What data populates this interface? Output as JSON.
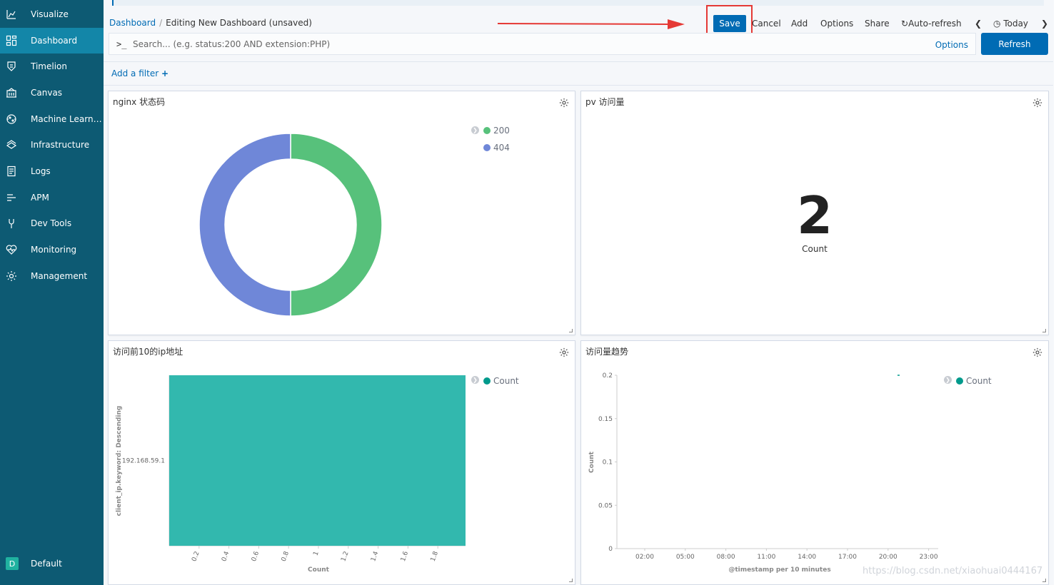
{
  "sidebar": {
    "items": [
      {
        "label": "Visualize",
        "icon": "visualize-icon"
      },
      {
        "label": "Dashboard",
        "icon": "dashboard-icon",
        "active": true
      },
      {
        "label": "Timelion",
        "icon": "timelion-icon"
      },
      {
        "label": "Canvas",
        "icon": "canvas-icon"
      },
      {
        "label": "Machine Learni...",
        "icon": "machine-learning-icon"
      },
      {
        "label": "Infrastructure",
        "icon": "infrastructure-icon"
      },
      {
        "label": "Logs",
        "icon": "logs-icon"
      },
      {
        "label": "APM",
        "icon": "apm-icon"
      },
      {
        "label": "Dev Tools",
        "icon": "dev-tools-icon"
      },
      {
        "label": "Monitoring",
        "icon": "monitoring-icon"
      },
      {
        "label": "Management",
        "icon": "management-icon"
      }
    ],
    "space": {
      "badge": "D",
      "label": "Default"
    }
  },
  "breadcrumb": {
    "root": "Dashboard",
    "sep": "/",
    "current": "Editing New Dashboard (unsaved)"
  },
  "menu": {
    "save": "Save",
    "cancel": "Cancel",
    "add": "Add",
    "options": "Options",
    "share": "Share",
    "auto_refresh": "Auto-refresh",
    "today": "Today"
  },
  "query": {
    "prompt": ">_",
    "placeholder": "Search... (e.g. status:200 AND extension:PHP)",
    "options": "Options",
    "refresh": "Refresh"
  },
  "filters": {
    "add_label": "Add a filter"
  },
  "colors": {
    "accent": "#006bb4",
    "green": "#57c17b",
    "purple": "#6f87d8",
    "teal": "#32b8ae",
    "sidebar": "#0d5a73"
  },
  "panels": {
    "pie": {
      "title": "nginx 状态码",
      "chart_data": {
        "type": "pie",
        "donut": true,
        "categories": [
          "200",
          "404"
        ],
        "values": [
          1,
          1
        ],
        "colors": [
          "#57c17b",
          "#6f87d8"
        ]
      }
    },
    "metric": {
      "title": "pv 访问量",
      "value": "2",
      "label": "Count"
    },
    "bar": {
      "title": "访问前10的ip地址",
      "chart_data": {
        "type": "bar",
        "orientation": "horizontal",
        "categories": [
          "192.168.59.1"
        ],
        "values": [
          2
        ],
        "xlabel": "Count",
        "ylabel": "client_ip.keyword: Descending",
        "xticks": [
          "0.2",
          "0.4",
          "0.6",
          "0.8",
          "1",
          "1.2",
          "1.4",
          "1.6",
          "1.8"
        ],
        "legend": [
          "Count"
        ],
        "color": "#32b8ae"
      }
    },
    "line": {
      "title": "访问量趋势",
      "chart_data": {
        "type": "line",
        "xlabel": "@timestamp per 10 minutes",
        "ylabel": "Count",
        "yticks": [
          "0",
          "0.05",
          "0.1",
          "0.15",
          "0.2"
        ],
        "xticks": [
          "02:00",
          "05:00",
          "08:00",
          "11:00",
          "14:00",
          "17:00",
          "20:00",
          "23:00"
        ],
        "legend": [
          "Count"
        ],
        "color": "#009a8c"
      }
    }
  },
  "watermark": "https://blog.csdn.net/xiaohuai0444167"
}
